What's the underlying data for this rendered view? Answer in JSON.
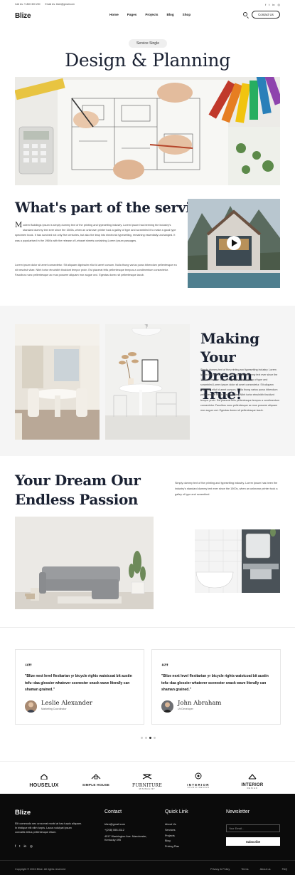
{
  "topbar": {
    "call": "Call Us: +1800 300 200",
    "email": "Email Us: blize@gmail.com",
    "social_icons": [
      "facebook-icon",
      "twitter-icon",
      "linkedin-icon",
      "instagram-icon"
    ],
    "social_glyphs": [
      "f",
      "t",
      "in",
      "◎"
    ]
  },
  "nav": {
    "logo": "Blize",
    "links": [
      "Home",
      "Pages",
      "Projects",
      "Blog",
      "Shop"
    ],
    "contact_label": "Contact Us"
  },
  "hero": {
    "badge": "Service Single",
    "title": "Design & Planning"
  },
  "service": {
    "title": "What's part of the service",
    "drop_cap": "M",
    "paragraph1": "odern Buildings Ipsum is simply dummy text of the printing and typesetting industry. Lorem Ipsum has beening the industry's standard dummy text ever since the 1500s, when an unknown printer took a galley of type and scrambled it to make a good type specimen book. It has survived not only five centuries, but also the leap into electronic typesetting, remaining essentially unchanged. It was a popularised in the 1960s with the release of Letraset sheets containing Lorem Ipsum passages.",
    "paragraph2": "Lorem ipsum dolor sit amet consectetur. Sit aliquam dignissim ellut id amet cursum. Nulla thung varius purus bibendum pellentesque eu sit nesctrut vitae. Nibh tortor etnulnibh tincidunt tempor proin. Est placerat felis pellentesque tempus a condimentum consectetur. Faucibus nunc pellentesque ac mus posuere aliquam mor augue orci. Egestas donec sit pellentesque iacub."
  },
  "dream_true": {
    "title": "Making Your Dream True!",
    "text": "Simply dummy text of the printing and typesetting industry. Lorem Ipsum has been the industry's standard dummy text ever since the 1500s, when an unknown printer took a galley of type and scrambled.Lorem ipsum dolor sit amet consectetur. Sit aliquam dignissim ellut id amet cursum. Nulla thung varius purus bibendum pellentesque eu sit nesctrut vitae. Nibh tortor etnulnibh tincidunt tempor proin. Est placerat felis pellentesque tempus a condimentum consectetur. Faucibus nunc pellentesque ac mus posuere aliquam mor augue orci. Egestas donec sit pellentesque iacub."
  },
  "passion": {
    "title": "Your Dream Our Endless Passion",
    "text": "Simply dummy text of the printing and typesetting industry. Lorem Ipsum has been the industry's standard dummy text ever since the 1500s, when an unknown printer took a galley of type and scrambled."
  },
  "testimonials": [
    {
      "quote": "\"Blize next level flexitarian yr bicycle rights waistcoat bit austin tofu–daa glossier whatever scenester snack wave literally can shaman grained.\"",
      "name": "Leslie Alexander",
      "role": "Marketing Coordinator"
    },
    {
      "quote": "\"Blize next level flexitarian yr bicycle rights waistcoat bit austin tofu–daa glossier whatever scenester snack wave literally can shaman grained.\"",
      "name": "John Abraham",
      "role": "Ux Developer"
    }
  ],
  "slider_dots": 4,
  "slider_active_index": 2,
  "brands": [
    {
      "name": "HOUSELUX",
      "sub": ""
    },
    {
      "name": "SIMPLE HOUSE",
      "sub": ""
    },
    {
      "name": "FURNITURE",
      "sub": "MINIMALIST"
    },
    {
      "name": "INTERIOR",
      "sub": "STUDIO DESIGN"
    },
    {
      "name": "INTERIOR",
      "sub": "DESIGN"
    }
  ],
  "footer": {
    "logo": "Blize",
    "description": "Elit commodo nec urna erat morbi at hac turpis aliquam. In tristique elit nibh turpis. Lacus volutpat ipsum convallis tellus pellentesque etiam.",
    "social_glyphs": [
      "f",
      "t",
      "in",
      "◎"
    ],
    "contact_title": "Contact",
    "contact_email": "blize@gmail.com",
    "contact_phone": "+(208) 555-0112",
    "contact_address": "4517 Washington Ave. Manchester, Kentucky 495",
    "quick_title": "Quick Link",
    "quick_links": [
      "About Us",
      "Services",
      "Projects",
      "Blog",
      "Pricing Plan"
    ],
    "newsletter_title": "Newsletter",
    "newsletter_placeholder": "Your Email...",
    "subscribe_label": "Subscribe",
    "copyright": "Copyright © 2024 Blize. All rights reserved",
    "bottom_links": [
      "Privacy & Policy",
      "Terms",
      "About us",
      "FAQ"
    ]
  }
}
